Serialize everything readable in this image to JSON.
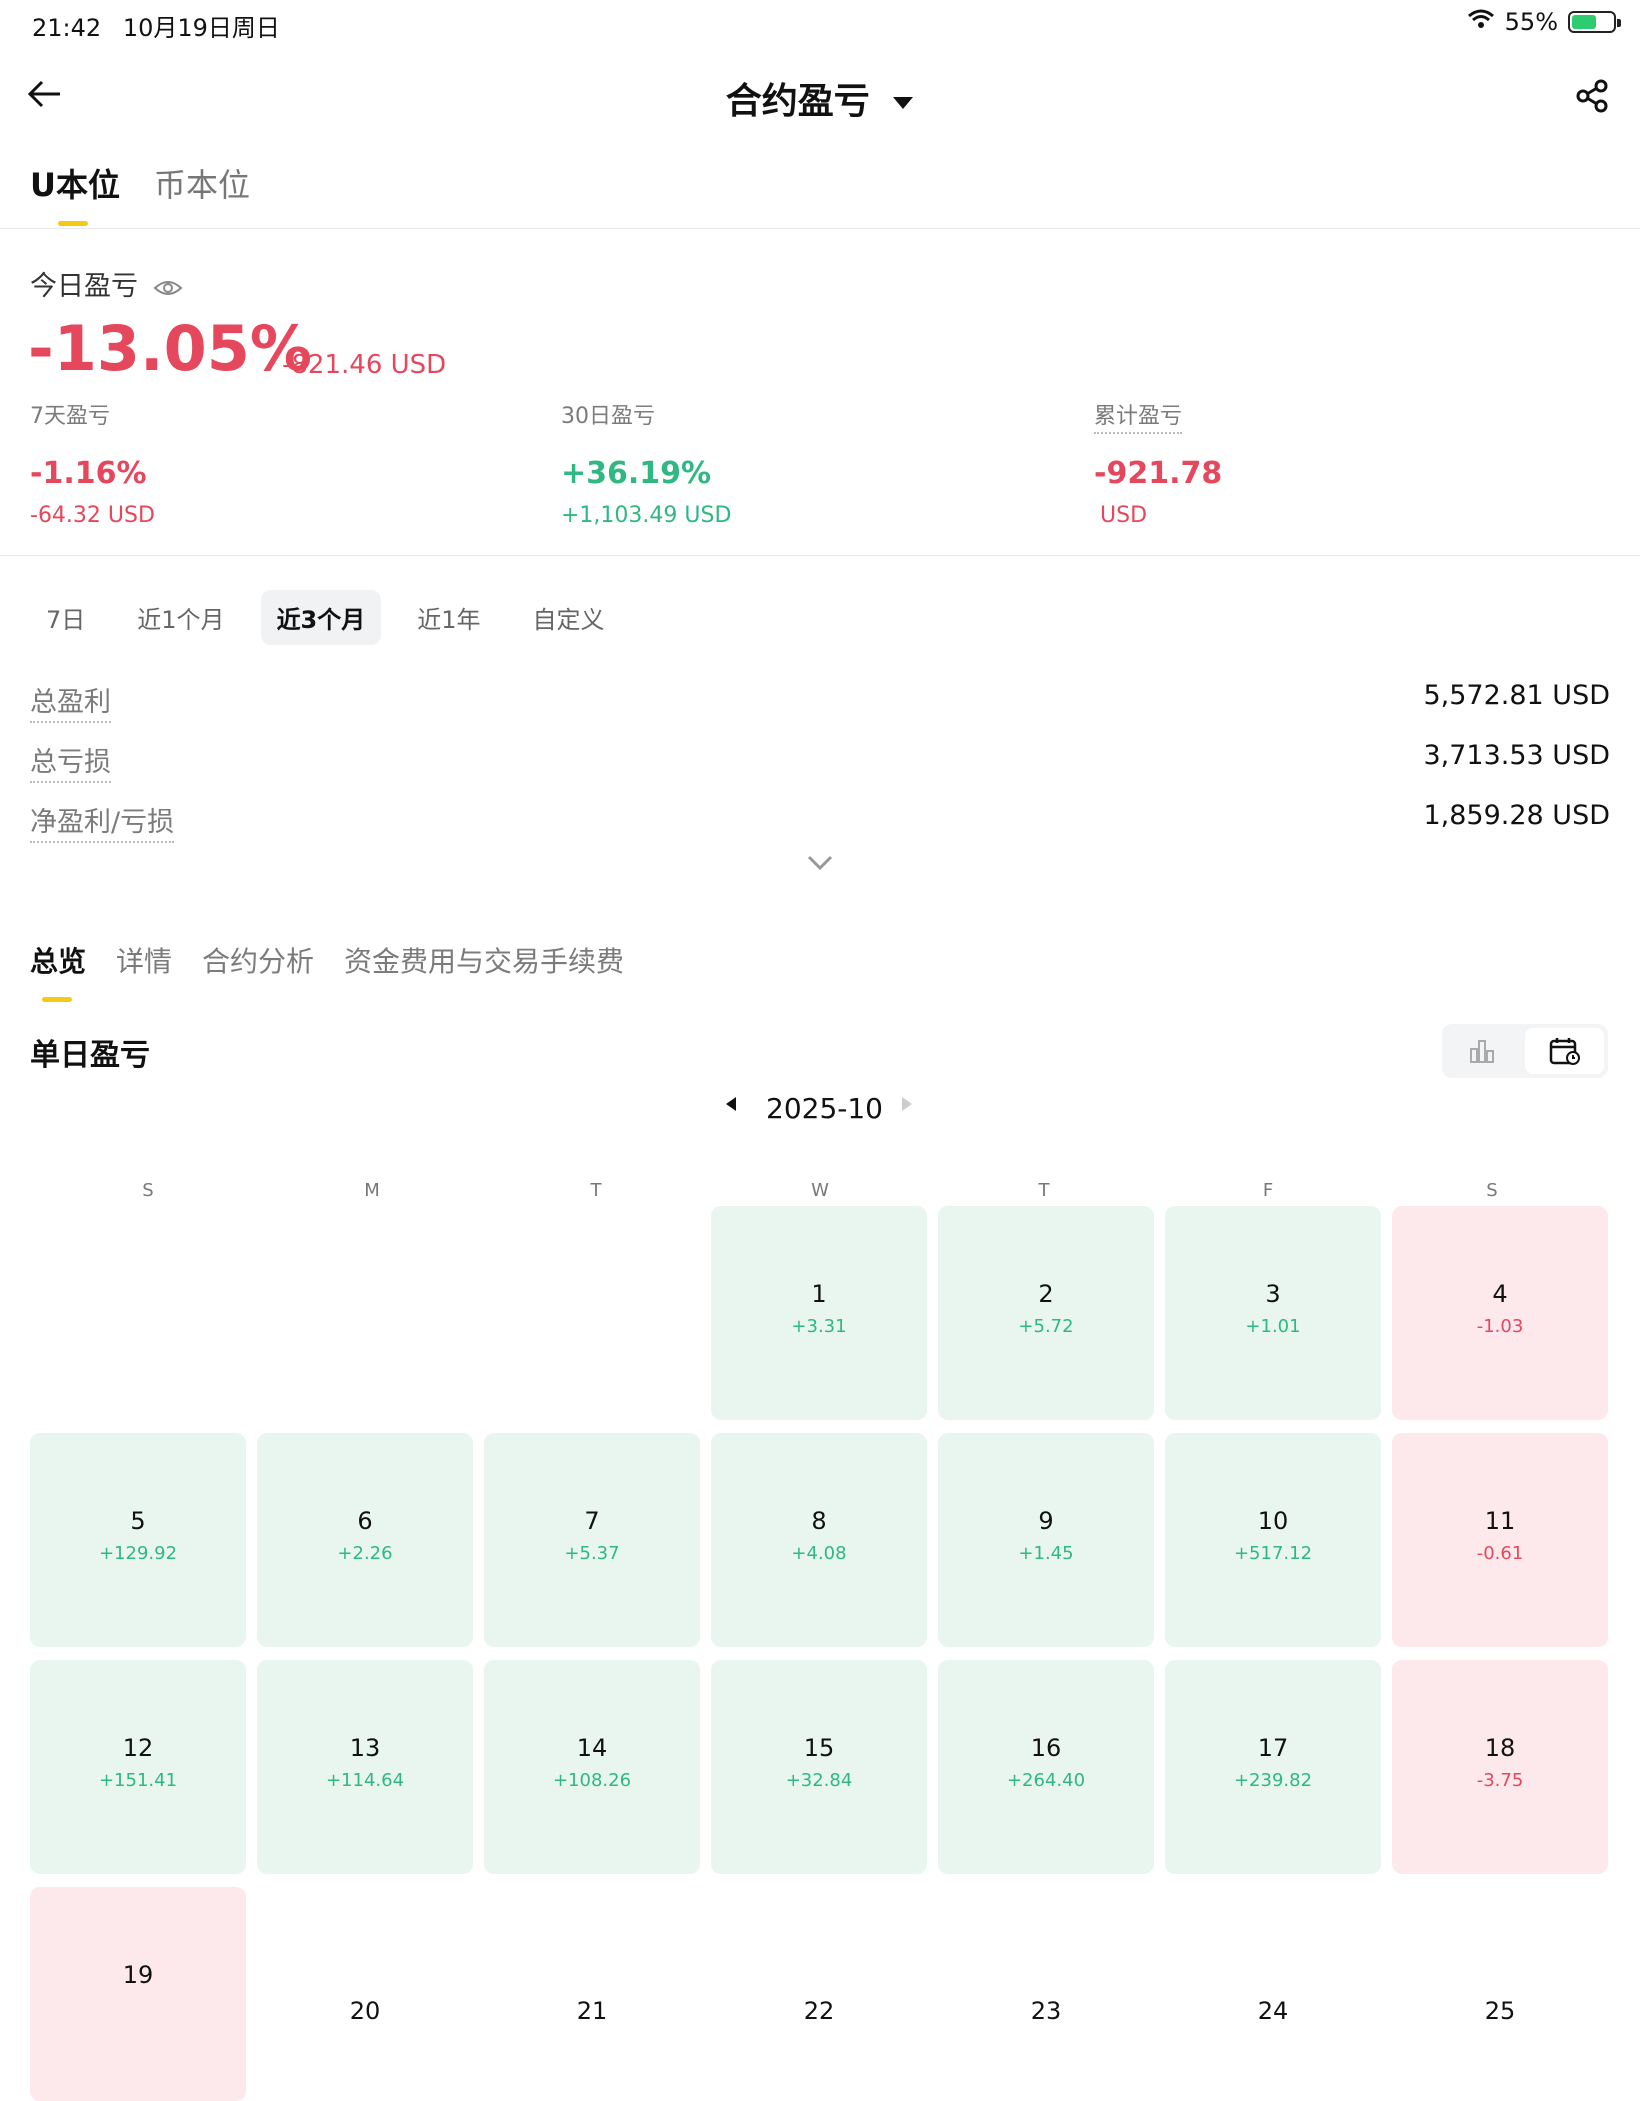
{
  "status_bar": {
    "time": "21:42",
    "date": "10月19日周日",
    "battery": "55%"
  },
  "header": {
    "title": "合约盈亏"
  },
  "top_tabs": [
    "U本位",
    "币本位"
  ],
  "today": {
    "label": "今日盈亏",
    "percent": "-13.05%",
    "amount": "-821.46 USD"
  },
  "summary": [
    {
      "label": "7天盈亏",
      "percent": "-1.16%",
      "amount": "-64.32 USD",
      "tone": "red"
    },
    {
      "label": "30日盈亏",
      "percent": "+36.19%",
      "amount": "+1,103.49 USD",
      "tone": "green"
    },
    {
      "label": "累计盈亏",
      "percent": "-921.78",
      "amount": "USD",
      "tone": "red"
    }
  ],
  "period_tabs": [
    "7日",
    "近1个月",
    "近3个月",
    "近1年",
    "自定义"
  ],
  "period_selected": "近3个月",
  "stats": [
    {
      "label": "总盈利",
      "value": "5,572.81 USD"
    },
    {
      "label": "总亏损",
      "value": "3,713.53 USD"
    },
    {
      "label": "净盈利/亏损",
      "value": "1,859.28 USD"
    }
  ],
  "section_tabs": [
    "总览",
    "详情",
    "合约分析",
    "资金费用与交易手续费"
  ],
  "daily_title": "单日盈亏",
  "calendar": {
    "month": "2025-10",
    "weekdays": [
      "S",
      "M",
      "T",
      "W",
      "T",
      "F",
      "S"
    ],
    "days": [
      {
        "day": "1",
        "value": "+3.31"
      },
      {
        "day": "2",
        "value": "+5.72"
      },
      {
        "day": "3",
        "value": "+1.01"
      },
      {
        "day": "4",
        "value": "-1.03"
      },
      {
        "day": "5",
        "value": "+129.92"
      },
      {
        "day": "6",
        "value": "+2.26"
      },
      {
        "day": "7",
        "value": "+5.37"
      },
      {
        "day": "8",
        "value": "+4.08"
      },
      {
        "day": "9",
        "value": "+1.45"
      },
      {
        "day": "10",
        "value": "+517.12"
      },
      {
        "day": "11",
        "value": "-0.61"
      },
      {
        "day": "12",
        "value": "+151.41"
      },
      {
        "day": "13",
        "value": "+114.64"
      },
      {
        "day": "14",
        "value": "+108.26"
      },
      {
        "day": "15",
        "value": "+32.84"
      },
      {
        "day": "16",
        "value": "+264.40"
      },
      {
        "day": "17",
        "value": "+239.82"
      },
      {
        "day": "18",
        "value": "-3.75"
      },
      {
        "day": "19",
        "value": ""
      },
      {
        "day": "20",
        "value": ""
      },
      {
        "day": "21",
        "value": ""
      },
      {
        "day": "22",
        "value": ""
      },
      {
        "day": "23",
        "value": ""
      },
      {
        "day": "24",
        "value": ""
      },
      {
        "day": "25",
        "value": ""
      }
    ]
  },
  "colors": {
    "accent": "#f5c918",
    "loss": "#e5475c",
    "profit": "#2fb881"
  }
}
